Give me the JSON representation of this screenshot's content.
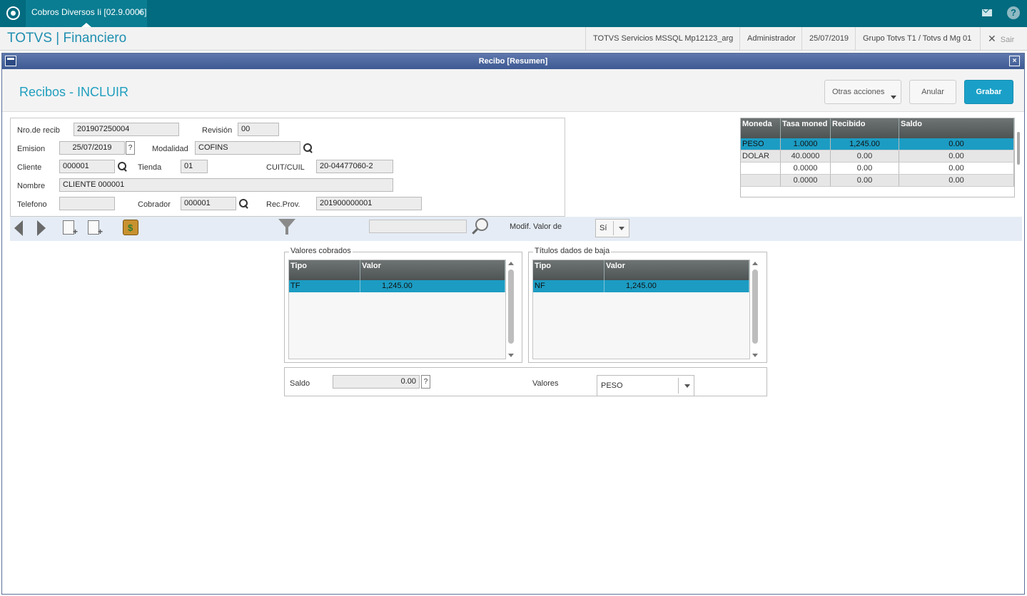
{
  "topbar": {
    "tab_label": "Cobros Diversos Ii [02.9.0006]",
    "tab_close": "×",
    "help": "?"
  },
  "header": {
    "brand": "TOTVS | Financiero",
    "environment": "TOTVS Servicios MSSQL Mp12123_arg",
    "user": "Administrador",
    "date": "25/07/2019",
    "group": "Grupo Totvs T1 / Totvs d Mg 01",
    "exit_label": "Sair"
  },
  "window": {
    "title": "Recibo [Resumen]",
    "close": "×",
    "page_title": "Recibos - INCLUIR",
    "actions": {
      "otras": "Otras acciones",
      "anular": "Anular",
      "grabar": "Grabar"
    }
  },
  "form": {
    "nro_label": "Nro.de recib",
    "nro_value": "201907250004",
    "revision_label": "Revisión",
    "revision_value": "00",
    "emision_label": "Emision",
    "emision_value": "25/07/2019",
    "question": "?",
    "modalidad_label": "Modalidad",
    "modalidad_value": "COFINS",
    "cliente_label": "Cliente",
    "cliente_value": "000001",
    "tienda_label": "Tienda",
    "tienda_value": "01",
    "cuit_label": "CUIT/CUIL",
    "cuit_value": "20-04477060-2",
    "nombre_label": "Nombre",
    "nombre_value": "CLIENTE 000001",
    "telefono_label": "Telefono",
    "telefono_value": "",
    "cobrador_label": "Cobrador",
    "cobrador_value": "000001",
    "recprov_label": "Rec.Prov.",
    "recprov_value": "201900000001"
  },
  "currency_table": {
    "headers": [
      "Moneda",
      "Tasa moned",
      "Recibido",
      "Saldo"
    ],
    "rows": [
      [
        "PESO",
        "1.0000",
        "1,245.00",
        "0.00"
      ],
      [
        "DOLAR",
        "40.0000",
        "0.00",
        "0.00"
      ],
      [
        "",
        "0.0000",
        "0.00",
        "0.00"
      ],
      [
        "",
        "0.0000",
        "0.00",
        "0.00"
      ]
    ]
  },
  "toolbar": {
    "search_value": "",
    "modif_label": "Modif. Valor de",
    "modif_value": "Sí"
  },
  "valores_cobrados": {
    "title": "Valores cobrados",
    "headers": [
      "Tipo",
      "Valor"
    ],
    "rows": [
      [
        "TF",
        "1,245.00"
      ]
    ]
  },
  "titulos": {
    "title": "Títulos dados de baja",
    "headers": [
      "Tipo",
      "Valor"
    ],
    "rows": [
      [
        "NF",
        "1,245.00"
      ]
    ]
  },
  "saldo": {
    "label": "Saldo",
    "value": "0.00",
    "question": "?",
    "valores_label": "Valores",
    "valores_value": "PESO"
  }
}
